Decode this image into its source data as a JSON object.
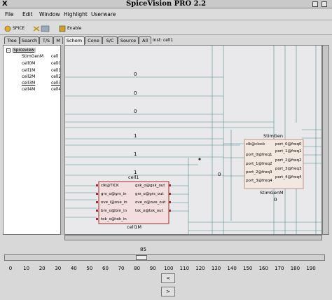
{
  "window": {
    "title": "SpiceVision PRO 2.2"
  },
  "menu": [
    "File",
    "Edit",
    "Window",
    "Highlight",
    "Userware"
  ],
  "toolbar": {
    "buttons": [
      {
        "label": "SPICE",
        "icon": "spice-icon"
      },
      {
        "label": "",
        "icon": "scissors-cells-icon"
      },
      {
        "label": "Enable",
        "icon": "enable-icon"
      }
    ]
  },
  "tabs": [
    "Tree",
    "Search",
    "T/S",
    "M",
    "Schem",
    "Cone",
    "S/C",
    "Source",
    "All"
  ],
  "active_tab": "Schem",
  "instance_label": "Inst: cell1",
  "tree": {
    "root": "Spiceview",
    "items": [
      "StimGenM",
      "cell0M",
      "cell1M",
      "cell2M",
      "cell3M",
      "cell4M"
    ],
    "items_right": [
      "cell",
      "cell0",
      "cell1",
      "cell2",
      "cell3",
      "cell4"
    ]
  },
  "schematic": {
    "wire_values": [
      "0",
      "0",
      "0",
      "1",
      "1",
      "1",
      "0",
      "0"
    ],
    "cell1": {
      "title": "cell1",
      "subtitle": "cell1M",
      "pins_left": [
        "clk@TICK",
        "grs_o@grs_in",
        "ove_i@ove_in",
        "bm_o@bm_in",
        "tok_o@tok_in"
      ],
      "pins_right": [
        "gsk_o@gsk_out",
        "grs_o@grs_out",
        "ove_o@ove_out",
        "tsk_o@tsk_out"
      ]
    },
    "stimgen": {
      "title": "StimGen",
      "subtitle": "StimGenM",
      "pins_left": [
        "clk@clock",
        "port_0@freq1",
        "port_1@freq2",
        "port_2@freq3",
        "port_3@freq4"
      ],
      "pins_right": [
        "port_0@freq0",
        "port_1@freq1",
        "port_2@freq2",
        "port_3@freq3",
        "port_4@freq4"
      ]
    }
  },
  "slider": {
    "value": "85",
    "fraction": 0.425,
    "ticks": [
      "0",
      "10",
      "20",
      "30",
      "40",
      "50",
      "60",
      "70",
      "80",
      "90",
      "100",
      "110",
      "120",
      "130",
      "140",
      "150",
      "160",
      "170",
      "180",
      "190"
    ]
  },
  "nav": {
    "prev": "<",
    "next": ">"
  }
}
